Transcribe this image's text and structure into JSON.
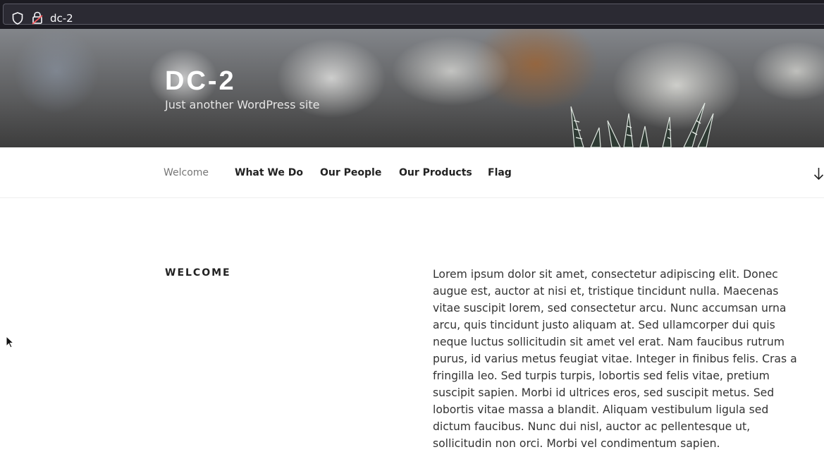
{
  "browser": {
    "url": "dc-2",
    "icons": [
      "shield-icon",
      "lock-icon"
    ]
  },
  "header": {
    "site_title": "DC-2",
    "site_description": "Just another WordPress site"
  },
  "nav": {
    "items": [
      {
        "label": "Welcome",
        "current": true
      },
      {
        "label": "What We Do",
        "current": false
      },
      {
        "label": "Our People",
        "current": false
      },
      {
        "label": "Our Products",
        "current": false
      },
      {
        "label": "Flag",
        "current": false
      }
    ],
    "scroll_icon": "arrow-down-icon"
  },
  "main": {
    "section_title": "WELCOME",
    "body": "Lorem ipsum dolor sit amet, consectetur adipiscing elit. Donec augue est, auctor at nisi et, tristique tincidunt nulla. Maecenas vitae suscipit lorem, sed consectetur arcu. Nunc accumsan urna arcu, quis tincidunt justo aliquam at. Sed ullamcorper dui quis neque luctus sollicitudin sit amet vel erat. Nam faucibus rutrum purus, id varius metus feugiat vitae. Integer in finibus felis. Cras a fringilla leo. Sed turpis turpis, lobortis sed felis vitae, pretium suscipit sapien. Morbi id ultrices eros, sed suscipit metus. Sed lobortis vitae massa a blandit. Aliquam vestibulum ligula sed dictum faucibus. Nunc dui nisl, auctor ac pellentesque ut, sollicitudin non orci. Morbi vel condimentum sapien."
  },
  "colors": {
    "browser_bg": "#1c1b22",
    "url_field_bg": "#2b2a33",
    "nav_current": "#767676",
    "text": "#222222"
  }
}
